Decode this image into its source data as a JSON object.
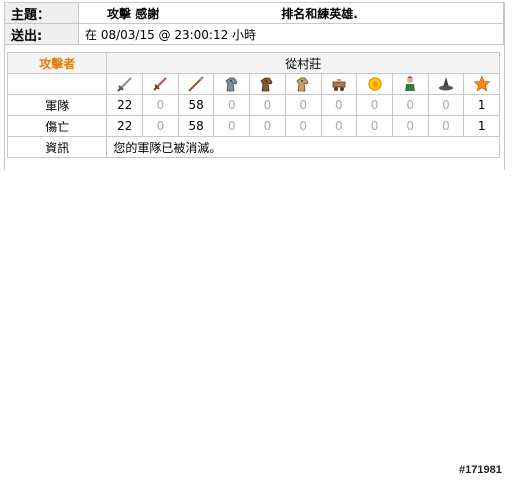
{
  "message": {
    "subject_label": "主題：",
    "subject_part1": "攻擊",
    "subject_part2": "感謝",
    "subject_part3": "排名和練英雄.",
    "sent_label": "送出:",
    "sent_value": "在 08/03/15 @ 23:00:12 小時"
  },
  "report": {
    "attacker_label": "攻擊者",
    "village": "從村莊",
    "units": [
      {
        "icon": "sword-icon"
      },
      {
        "icon": "dagger-icon"
      },
      {
        "icon": "spear-icon"
      },
      {
        "icon": "knight-horse-icon"
      },
      {
        "icon": "horse-icon"
      },
      {
        "icon": "horse-light-icon"
      },
      {
        "icon": "ram-icon"
      },
      {
        "icon": "catapult-fire-icon"
      },
      {
        "icon": "chief-icon"
      },
      {
        "icon": "settler-hat-icon"
      },
      {
        "icon": "hero-star-icon"
      }
    ],
    "rows": [
      {
        "label": "軍隊",
        "values": [
          "22",
          "0",
          "58",
          "0",
          "0",
          "0",
          "0",
          "0",
          "0",
          "0",
          "1"
        ]
      },
      {
        "label": "傷亡",
        "values": [
          "22",
          "0",
          "58",
          "0",
          "0",
          "0",
          "0",
          "0",
          "0",
          "0",
          "1"
        ]
      }
    ],
    "info_label": "資訊",
    "info_text": "您的軍隊已被消滅。"
  },
  "footer": {
    "image_id": "#171981"
  }
}
